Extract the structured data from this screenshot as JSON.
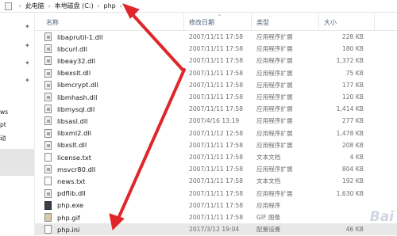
{
  "breadcrumb": [
    "此电脑",
    "本地磁盘 (C:)",
    "php"
  ],
  "nav": {
    "labels": [
      "ws",
      "pt",
      "动"
    ]
  },
  "columns": {
    "name": "名称",
    "date": "修改日期",
    "type": "类型",
    "size": "大小"
  },
  "files": [
    {
      "name": "libaprutil-1.dll",
      "date": "2007/11/11 17:58",
      "type": "应用程序扩展",
      "size": "228 KB",
      "icon": "dll"
    },
    {
      "name": "libcurl.dll",
      "date": "2007/11/11 17:58",
      "type": "应用程序扩展",
      "size": "180 KB",
      "icon": "dll"
    },
    {
      "name": "libeay32.dll",
      "date": "2007/11/11 17:58",
      "type": "应用程序扩展",
      "size": "1,372 KB",
      "icon": "dll"
    },
    {
      "name": "libexslt.dll",
      "date": "2007/11/11 17:58",
      "type": "应用程序扩展",
      "size": "75 KB",
      "icon": "dll"
    },
    {
      "name": "libmcrypt.dll",
      "date": "2007/11/11 17:58",
      "type": "应用程序扩展",
      "size": "177 KB",
      "icon": "dll"
    },
    {
      "name": "libmhash.dll",
      "date": "2007/11/11 17:58",
      "type": "应用程序扩展",
      "size": "120 KB",
      "icon": "dll"
    },
    {
      "name": "libmysql.dll",
      "date": "2007/11/11 17:58",
      "type": "应用程序扩展",
      "size": "1,414 KB",
      "icon": "dll"
    },
    {
      "name": "libsasl.dll",
      "date": "2007/4/16 13:19",
      "type": "应用程序扩展",
      "size": "277 KB",
      "icon": "dll"
    },
    {
      "name": "libxml2.dll",
      "date": "2007/11/12 12:58",
      "type": "应用程序扩展",
      "size": "1,478 KB",
      "icon": "dll"
    },
    {
      "name": "libxslt.dll",
      "date": "2007/11/11 17:58",
      "type": "应用程序扩展",
      "size": "208 KB",
      "icon": "dll"
    },
    {
      "name": "license.txt",
      "date": "2007/11/11 17:58",
      "type": "文本文档",
      "size": "4 KB",
      "icon": "doc"
    },
    {
      "name": "msvcr80.dll",
      "date": "2007/11/11 17:58",
      "type": "应用程序扩展",
      "size": "804 KB",
      "icon": "dll"
    },
    {
      "name": "news.txt",
      "date": "2007/11/11 17:58",
      "type": "文本文档",
      "size": "192 KB",
      "icon": "doc"
    },
    {
      "name": "pdflib.dll",
      "date": "2007/11/11 17:58",
      "type": "应用程序扩展",
      "size": "1,630 KB",
      "icon": "dll"
    },
    {
      "name": "php.exe",
      "date": "2007/11/11 17:58",
      "type": "应用程序",
      "size": "",
      "icon": "exe"
    },
    {
      "name": "php.gif",
      "date": "2007/11/11 17:58",
      "type": "GIF 图像",
      "size": "",
      "icon": "gif"
    },
    {
      "name": "php.ini",
      "date": "2017/3/12 19:04",
      "type": "配置设置",
      "size": "46 KB",
      "icon": "doc"
    }
  ],
  "selected_row": "php.ini",
  "annotation_color": "#e0262a",
  "watermark": "Bai"
}
